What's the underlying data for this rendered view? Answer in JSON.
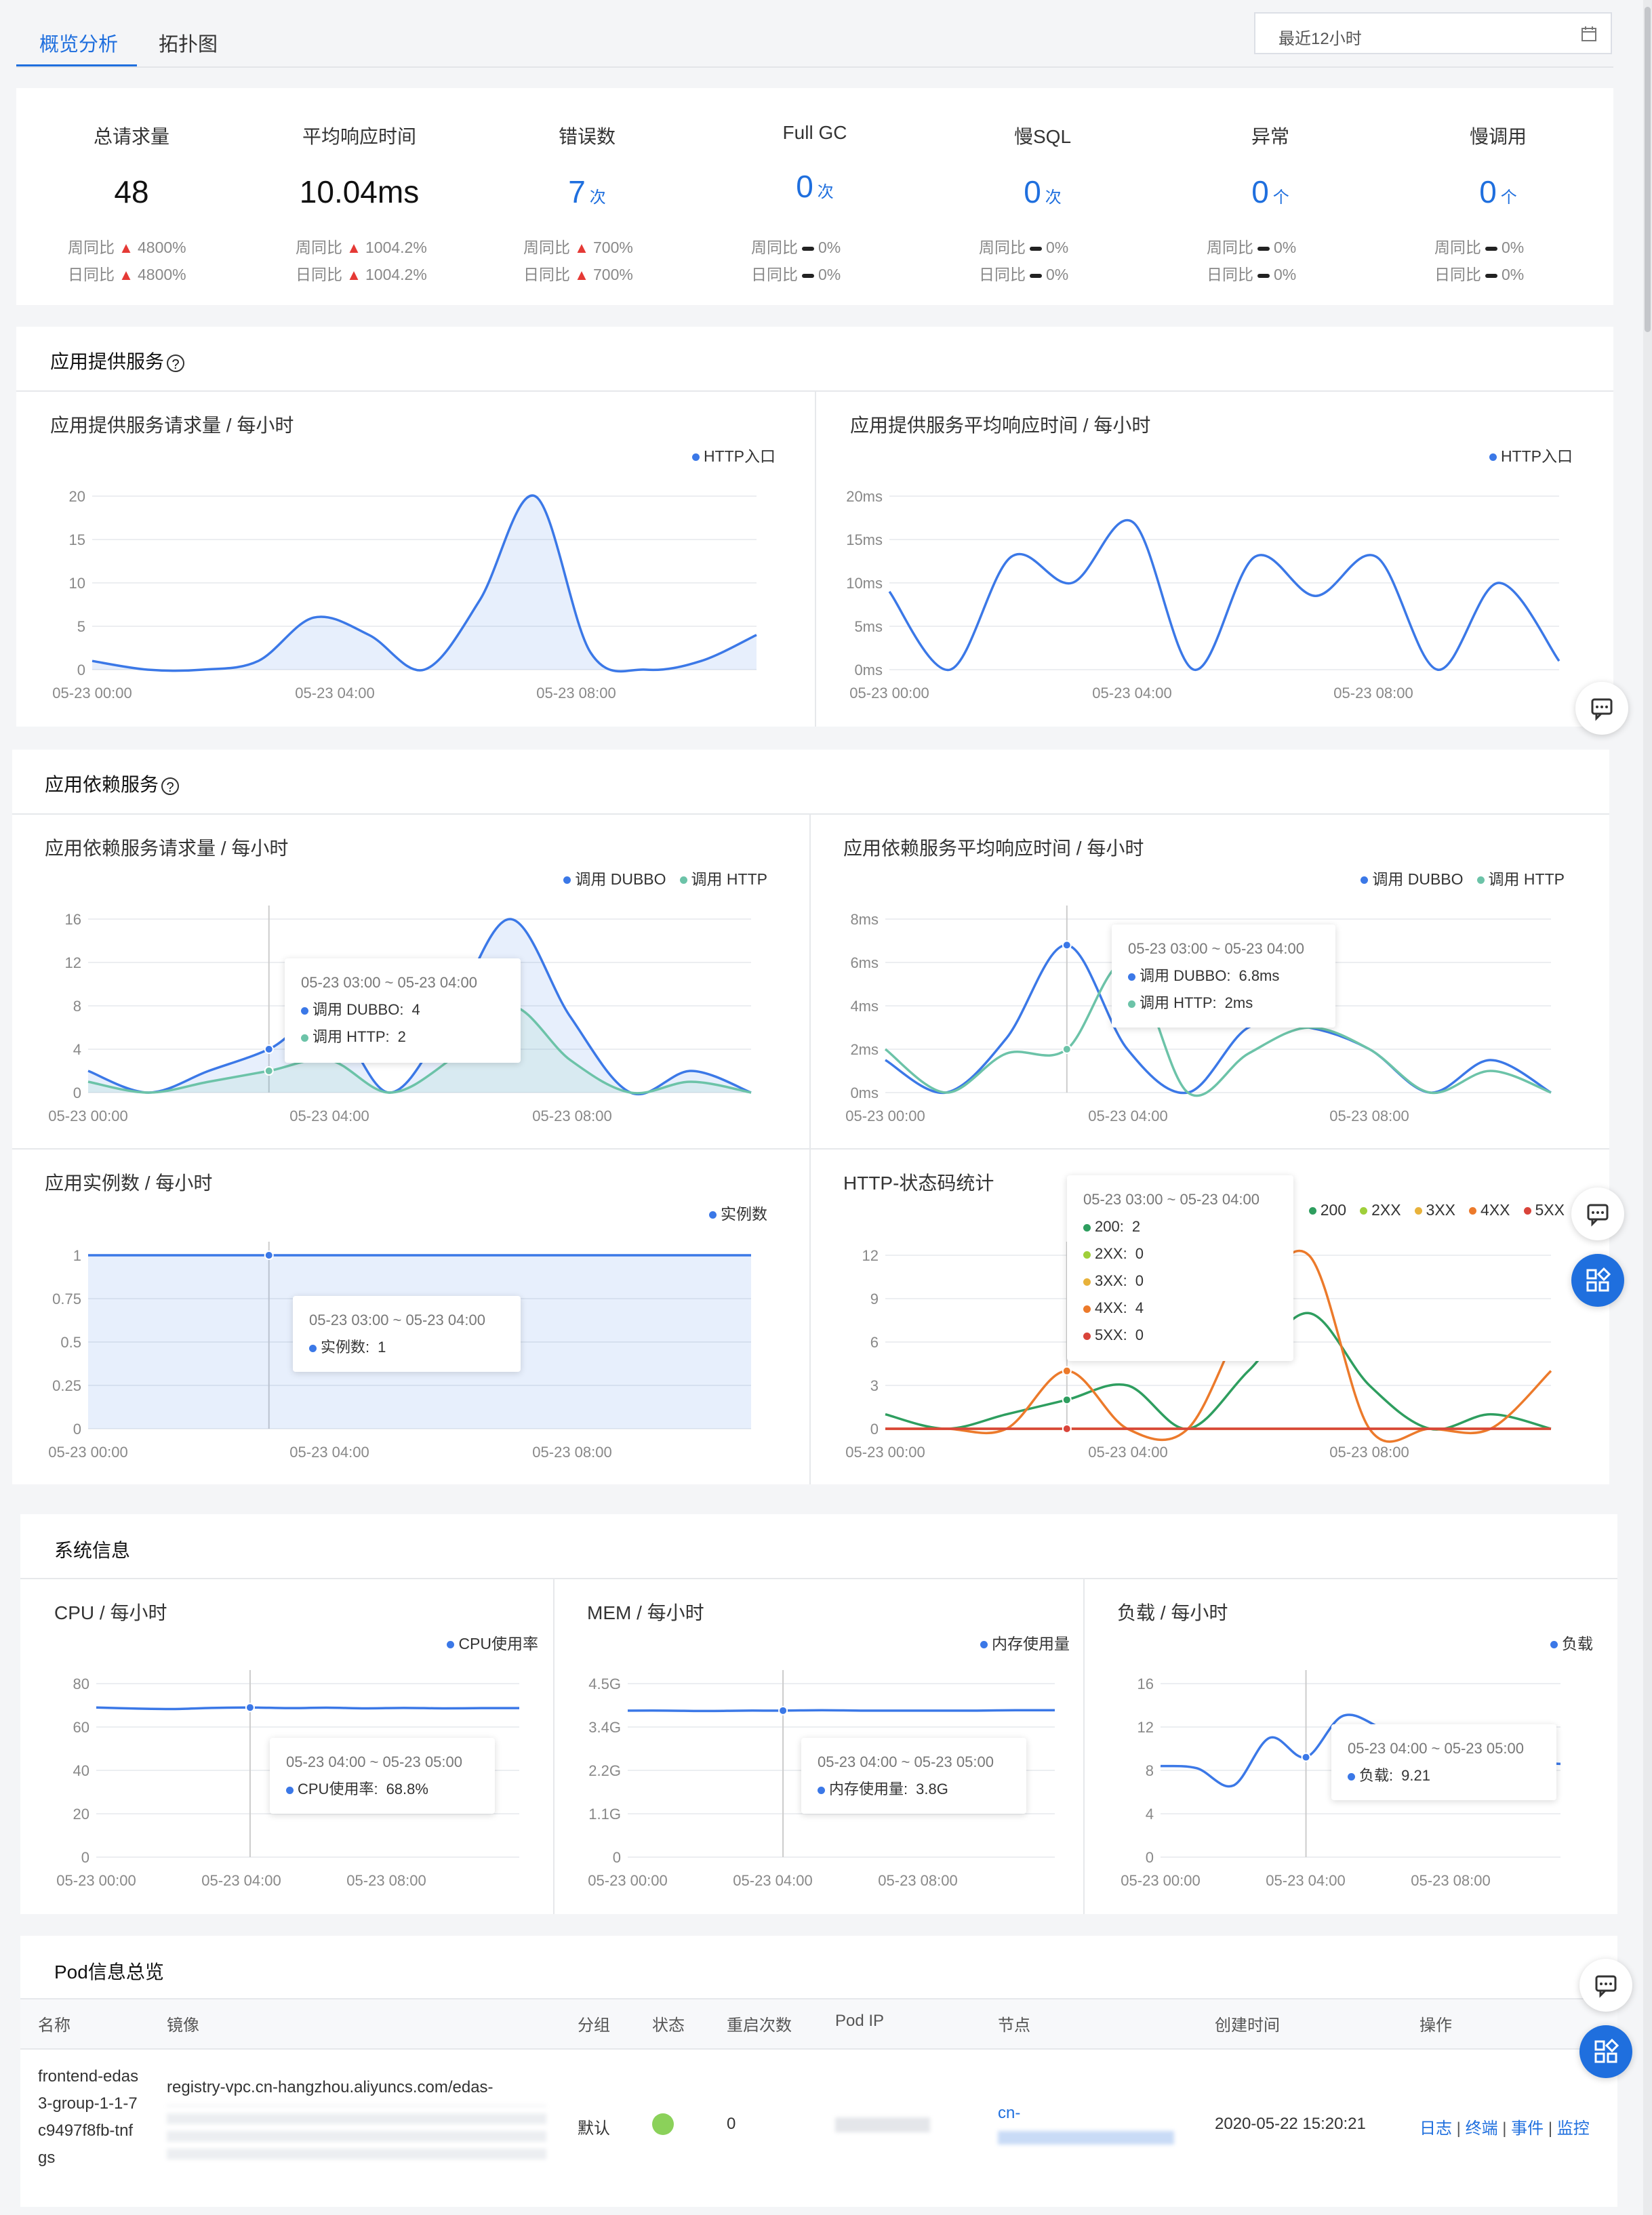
{
  "tabs": [
    {
      "label": "概览分析",
      "active": true
    },
    {
      "label": "拓扑图",
      "active": false
    }
  ],
  "time_range": "最近12小时",
  "stats": [
    {
      "label": "总请求量",
      "value": "48",
      "unit": "",
      "wow": "4800%",
      "dod": "4800%",
      "trend": "up"
    },
    {
      "label": "平均响应时间",
      "value": "10.04ms",
      "unit": "",
      "wow": "1004.2%",
      "dod": "1004.2%",
      "trend": "up"
    },
    {
      "label": "错误数",
      "value": "7",
      "unit": "次",
      "wow": "700%",
      "dod": "700%",
      "trend": "up"
    },
    {
      "label": "Full GC",
      "value": "0",
      "unit": "次",
      "wow": "0%",
      "dod": "0%",
      "trend": "flat"
    },
    {
      "label": "慢SQL",
      "value": "0",
      "unit": "次",
      "wow": "0%",
      "dod": "0%",
      "trend": "flat"
    },
    {
      "label": "异常",
      "value": "0",
      "unit": "个",
      "wow": "0%",
      "dod": "0%",
      "trend": "flat"
    },
    {
      "label": "慢调用",
      "value": "0",
      "unit": "个",
      "wow": "0%",
      "dod": "0%",
      "trend": "flat"
    }
  ],
  "wow_label": "周同比",
  "dod_label": "日同比",
  "sections": {
    "provide": "应用提供服务",
    "depend": "应用依赖服务",
    "system": "系统信息",
    "pod": "Pod信息总览"
  },
  "help_icon": "?",
  "colors": {
    "blue": "#3b78e7",
    "teal": "#6cc3a8",
    "green": "#2e9e5f",
    "lime": "#9fcf3a",
    "yellow": "#e8b23b",
    "orange": "#ec7a2b",
    "red": "#d9443a"
  },
  "chart_data": [
    {
      "id": "provide_req",
      "type": "area",
      "title": "应用提供服务请求量 / 每小时",
      "x": [
        "05-23 00:00",
        "05-23 04:00",
        "05-23 08:00"
      ],
      "ylim": [
        0,
        20
      ],
      "yticks": [
        "0",
        "5",
        "10",
        "15",
        "20"
      ],
      "series": [
        {
          "name": "HTTP入口",
          "color": "#3b78e7",
          "values": [
            1,
            0,
            0,
            1,
            6,
            4,
            0,
            8,
            20,
            2,
            0,
            1,
            4
          ]
        }
      ]
    },
    {
      "id": "provide_rt",
      "type": "line",
      "title": "应用提供服务平均响应时间 / 每小时",
      "x": [
        "05-23 00:00",
        "05-23 04:00",
        "05-23 08:00"
      ],
      "ylim": [
        0,
        20
      ],
      "yticks": [
        "0ms",
        "5ms",
        "10ms",
        "15ms",
        "20ms"
      ],
      "series": [
        {
          "name": "HTTP入口",
          "color": "#3b78e7",
          "values": [
            9,
            0,
            13,
            10,
            17,
            0,
            13,
            8.5,
            13,
            0,
            10,
            1
          ]
        }
      ]
    },
    {
      "id": "depend_req",
      "type": "area",
      "title": "应用依赖服务请求量 / 每小时",
      "x": [
        "05-23 00:00",
        "05-23 04:00",
        "05-23 08:00"
      ],
      "ylim": [
        0,
        16
      ],
      "yticks": [
        "0",
        "4",
        "8",
        "12",
        "16"
      ],
      "series": [
        {
          "name": "调用 DUBBO",
          "color": "#3b78e7",
          "values": [
            2,
            0,
            2,
            4,
            7,
            0,
            7,
            16,
            7,
            0,
            2,
            0
          ]
        },
        {
          "name": "调用 HTTP",
          "color": "#6cc3a8",
          "values": [
            1,
            0,
            1,
            2,
            3,
            0,
            3,
            8,
            3,
            0,
            1,
            0
          ]
        }
      ],
      "tooltip": {
        "title": "05-23 03:00 ~ 05-23 04:00",
        "rows": [
          {
            "label": "调用 DUBBO:",
            "value": "4",
            "color": "#3b78e7"
          },
          {
            "label": "调用 HTTP:",
            "value": "2",
            "color": "#6cc3a8"
          }
        ]
      }
    },
    {
      "id": "depend_rt",
      "type": "line",
      "title": "应用依赖服务平均响应时间 / 每小时",
      "x": [
        "05-23 00:00",
        "05-23 04:00",
        "05-23 08:00"
      ],
      "ylim": [
        0,
        8
      ],
      "yticks": [
        "0ms",
        "2ms",
        "4ms",
        "6ms",
        "8ms"
      ],
      "series": [
        {
          "name": "调用 DUBBO",
          "color": "#3b78e7",
          "values": [
            1.5,
            0,
            2.5,
            6.8,
            2,
            0,
            3,
            3,
            2,
            0,
            1.5,
            0
          ]
        },
        {
          "name": "调用 HTTP",
          "color": "#6cc3a8",
          "values": [
            2,
            0,
            1.8,
            2,
            6,
            0,
            1.8,
            3,
            2,
            0,
            1,
            0
          ]
        }
      ],
      "tooltip": {
        "title": "05-23 03:00 ~ 05-23 04:00",
        "rows": [
          {
            "label": "调用 DUBBO:",
            "value": "6.8ms",
            "color": "#3b78e7"
          },
          {
            "label": "调用 HTTP:",
            "value": "2ms",
            "color": "#6cc3a8"
          }
        ]
      }
    },
    {
      "id": "instances",
      "type": "area",
      "title": "应用实例数 / 每小时",
      "x": [
        "05-23 00:00",
        "05-23 04:00",
        "05-23 08:00"
      ],
      "ylim": [
        0,
        1
      ],
      "yticks": [
        "0",
        "0.25",
        "0.5",
        "0.75",
        "1"
      ],
      "series": [
        {
          "name": "实例数",
          "color": "#3b78e7",
          "values": [
            1,
            1,
            1,
            1,
            1,
            1,
            1,
            1,
            1,
            1,
            1,
            1
          ]
        }
      ],
      "tooltip": {
        "title": "05-23 03:00 ~ 05-23 04:00",
        "rows": [
          {
            "label": "实例数:",
            "value": "1",
            "color": "#3b78e7"
          }
        ]
      }
    },
    {
      "id": "http_status",
      "type": "line",
      "title": "HTTP-状态码统计",
      "x": [
        "05-23 00:00",
        "05-23 04:00",
        "05-23 08:00"
      ],
      "ylim": [
        0,
        12
      ],
      "yticks": [
        "0",
        "3",
        "6",
        "9",
        "12"
      ],
      "series": [
        {
          "name": "200",
          "color": "#2e9e5f",
          "values": [
            1,
            0,
            1,
            2,
            3,
            0,
            4,
            8,
            3,
            0,
            1,
            0
          ]
        },
        {
          "name": "2XX",
          "color": "#9fcf3a",
          "values": [
            0,
            0,
            0,
            0,
            0,
            0,
            0,
            0,
            0,
            0,
            0,
            0
          ]
        },
        {
          "name": "3XX",
          "color": "#e8b23b",
          "values": [
            0,
            0,
            0,
            0,
            0,
            0,
            0,
            0,
            0,
            0,
            0,
            0
          ]
        },
        {
          "name": "4XX",
          "color": "#ec7a2b",
          "values": [
            0,
            0,
            0,
            4,
            0,
            0,
            8,
            12,
            0,
            0,
            0,
            4
          ]
        },
        {
          "name": "5XX",
          "color": "#d9443a",
          "values": [
            0,
            0,
            0,
            0,
            0,
            0,
            0,
            0,
            0,
            0,
            0,
            0
          ]
        }
      ],
      "tooltip": {
        "title": "05-23 03:00 ~ 05-23 04:00",
        "rows": [
          {
            "label": "200:",
            "value": "2",
            "color": "#2e9e5f"
          },
          {
            "label": "2XX:",
            "value": "0",
            "color": "#9fcf3a"
          },
          {
            "label": "3XX:",
            "value": "0",
            "color": "#e8b23b"
          },
          {
            "label": "4XX:",
            "value": "4",
            "color": "#ec7a2b"
          },
          {
            "label": "5XX:",
            "value": "0",
            "color": "#d9443a"
          }
        ]
      }
    },
    {
      "id": "cpu",
      "type": "line",
      "title": "CPU / 每小时",
      "x": [
        "05-23 00:00",
        "05-23 04:00",
        "05-23 08:00"
      ],
      "ylim": [
        0,
        80
      ],
      "yticks": [
        "0",
        "20",
        "40",
        "60",
        "80"
      ],
      "series": [
        {
          "name": "CPU使用率",
          "color": "#3b78e7",
          "values": [
            69,
            68.5,
            68.3,
            68.8,
            69,
            68.7,
            68.9,
            68.6,
            68.8,
            68.6,
            68.7,
            68.7
          ]
        }
      ],
      "tooltip": {
        "title": "05-23 04:00 ~ 05-23 05:00",
        "rows": [
          {
            "label": "CPU使用率:",
            "value": "68.8%",
            "color": "#3b78e7"
          }
        ]
      }
    },
    {
      "id": "mem",
      "type": "line",
      "title": "MEM / 每小时",
      "x": [
        "05-23 00:00",
        "05-23 04:00",
        "05-23 08:00"
      ],
      "ylim": [
        0,
        4.5
      ],
      "yticks": [
        "0",
        "1.1G",
        "2.2G",
        "3.4G",
        "4.5G"
      ],
      "series": [
        {
          "name": "内存使用量",
          "color": "#3b78e7",
          "values": [
            3.8,
            3.8,
            3.79,
            3.8,
            3.8,
            3.81,
            3.8,
            3.8,
            3.8,
            3.8,
            3.81,
            3.81
          ]
        }
      ],
      "tooltip": {
        "title": "05-23 04:00 ~ 05-23 05:00",
        "rows": [
          {
            "label": "内存使用量:",
            "value": "3.8G",
            "color": "#3b78e7"
          }
        ]
      }
    },
    {
      "id": "load",
      "type": "line",
      "title": "负载 / 每小时",
      "x": [
        "05-23 00:00",
        "05-23 04:00",
        "05-23 08:00"
      ],
      "ylim": [
        0,
        16
      ],
      "yticks": [
        "0",
        "4",
        "8",
        "12",
        "16"
      ],
      "series": [
        {
          "name": "负载",
          "color": "#3b78e7",
          "values": [
            8.4,
            8.2,
            6.6,
            11,
            9.21,
            13,
            12,
            10,
            9,
            8.5,
            8.7,
            8.6
          ]
        }
      ],
      "tooltip": {
        "title": "05-23 04:00 ~ 05-23 05:00",
        "rows": [
          {
            "label": "负载:",
            "value": "9.21",
            "color": "#3b78e7"
          }
        ]
      }
    }
  ],
  "pod_table": {
    "headers": [
      "名称",
      "镜像",
      "分组",
      "状态",
      "重启次数",
      "Pod IP",
      "节点",
      "创建时间",
      "操作"
    ],
    "rows": [
      {
        "name": "frontend-edas3-group-1-1-7c9497f8fb-tnfgs",
        "image": "registry-vpc.cn-hangzhou.aliyuncs.com/edas-",
        "group": "默认",
        "status_color": "#8bd15a",
        "restarts": "0",
        "node": "cn-",
        "created": "2020-05-22 15:20:21"
      }
    ],
    "ops": [
      "日志",
      "终端",
      "事件",
      "监控"
    ]
  }
}
